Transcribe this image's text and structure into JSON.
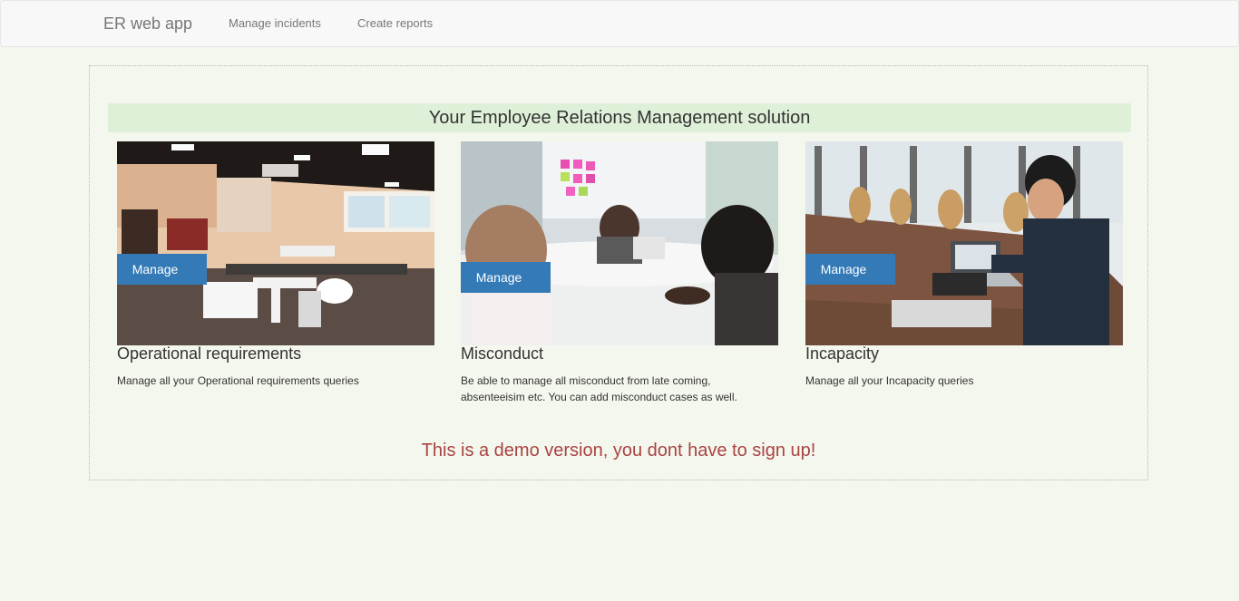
{
  "nav": {
    "brand": "ER web app",
    "links": [
      {
        "label": "Manage incidents"
      },
      {
        "label": "Create reports"
      }
    ]
  },
  "main": {
    "headline": "Your Employee Relations Management solution",
    "cards": [
      {
        "button": "Manage",
        "title": "Operational requirements",
        "description": "Manage all your Operational requirements queries",
        "image": "open-plan-office-photo"
      },
      {
        "button": "Manage",
        "title": "Misconduct",
        "description": "Be able to manage all misconduct from late coming, absenteeisim etc. You can add misconduct cases as well.",
        "image": "meeting-table-photo"
      },
      {
        "button": "Manage",
        "title": "Incapacity",
        "description": "Manage all your Incapacity queries",
        "image": "boardroom-laptop-photo"
      }
    ],
    "demo_note": "This is a demo version, you dont have to sign up!"
  },
  "colors": {
    "page_background": "#f4f7ee",
    "headline_background": "#dff0d8",
    "button": "#337ab7",
    "demo_note": "#a94442"
  }
}
